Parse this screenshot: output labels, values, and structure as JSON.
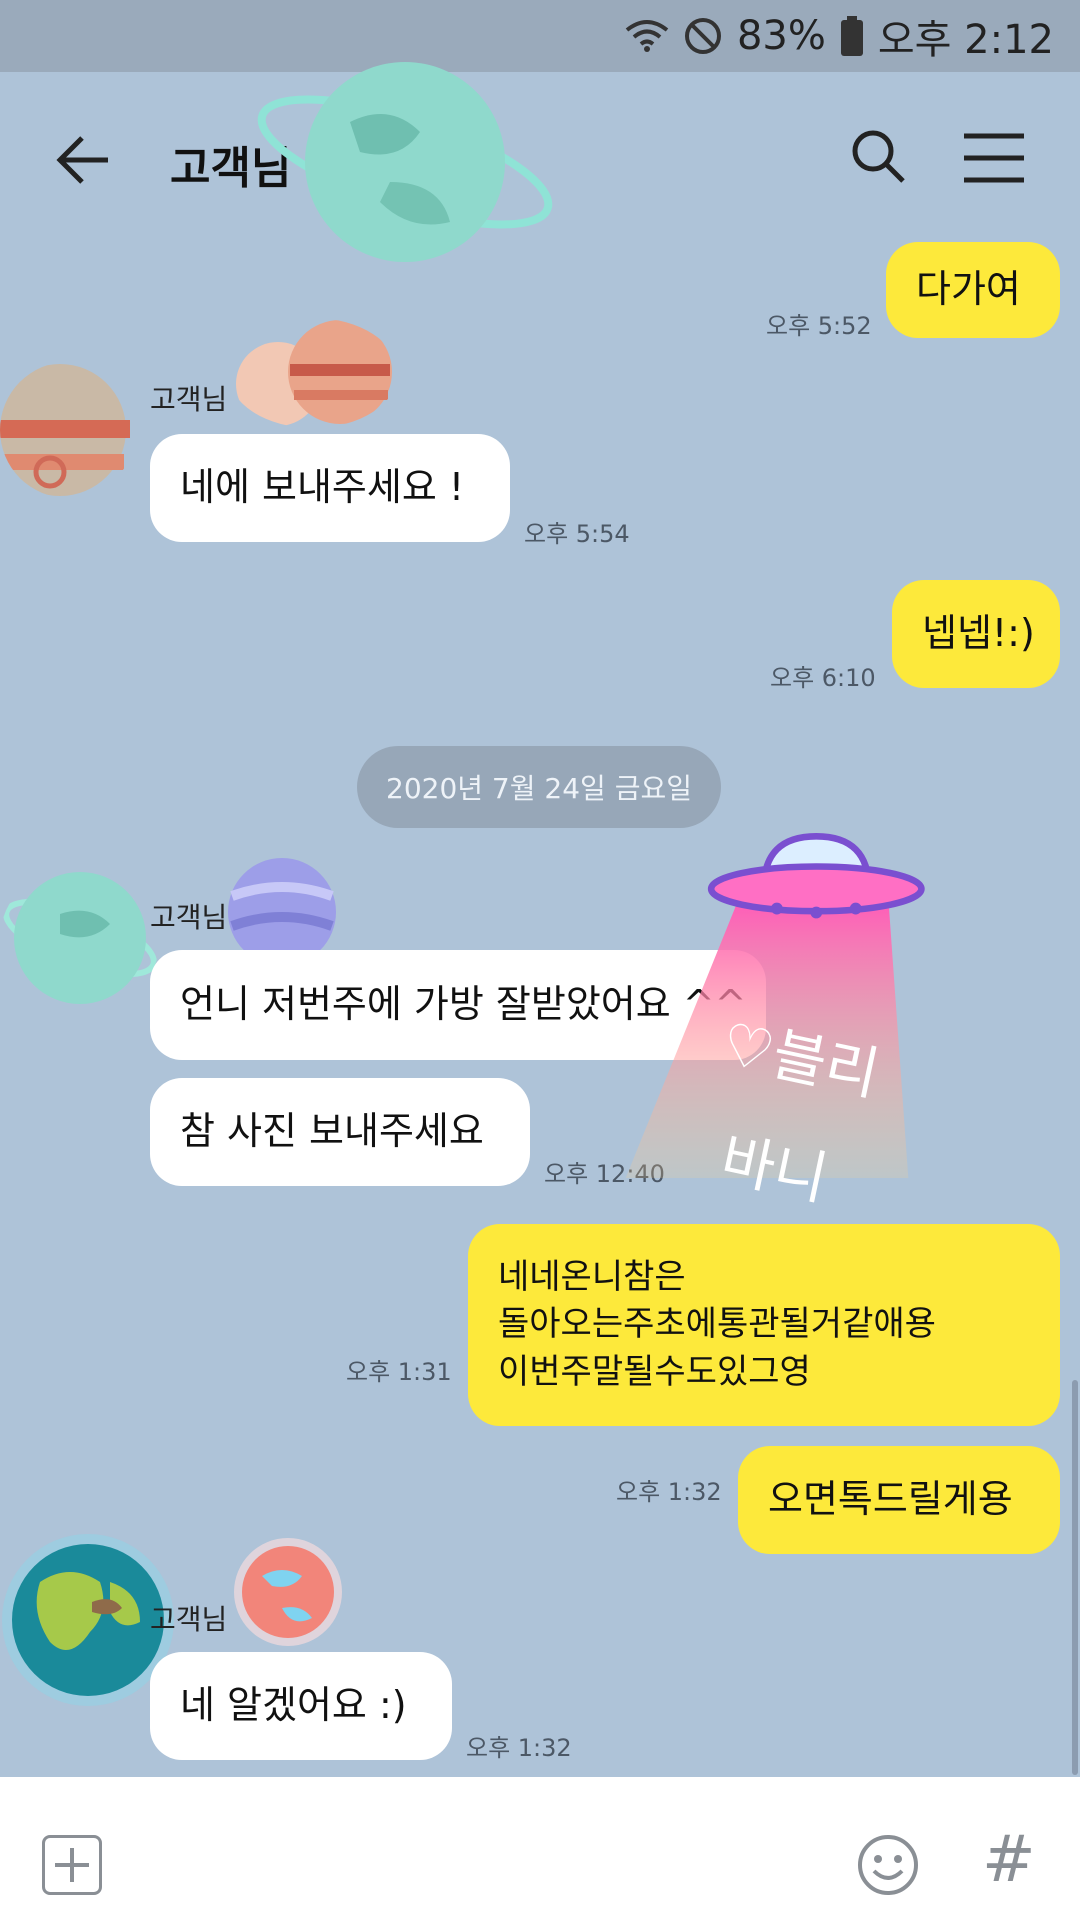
{
  "status": {
    "battery": "83%",
    "time": "오후 2:12"
  },
  "header": {
    "title": "고객님"
  },
  "messages": [
    {
      "text": "다가여",
      "time": "오후 5:52"
    },
    {
      "sender": "고객님",
      "text": "네에 보내주세요 !",
      "time": "오후 5:54"
    },
    {
      "text": "넵넵!:)",
      "time": "오후 6:10"
    },
    {
      "sender": "고객님",
      "text": "언니 저번주에 가방 잘받았어요 ^^"
    },
    {
      "text": "참 사진 보내주세요",
      "time": "오후 12:40"
    },
    {
      "lines": [
        "네네온니참은",
        "돌아오는주초에통관될거같애용",
        "이번주말될수도있그영"
      ],
      "time": "오후 1:31"
    },
    {
      "text": "오면톡드릴게용",
      "time": "오후 1:32"
    },
    {
      "sender": "고객님",
      "text": "네 알겠어요 :)",
      "time": "오후 1:32"
    }
  ],
  "date_divider": "2020년 7월 24일 금요일",
  "sticker": {
    "line1": "♡블리",
    "line2": "바니"
  },
  "colors": {
    "background": "#aec3d8",
    "outgoing_bubble": "#fde93b",
    "incoming_bubble": "#ffffff"
  },
  "icons": [
    "wifi-icon",
    "do-not-disturb-icon",
    "battery-icon",
    "back-arrow-icon",
    "search-icon",
    "menu-icon",
    "plus-icon",
    "emoji-icon",
    "hashtag-icon"
  ]
}
